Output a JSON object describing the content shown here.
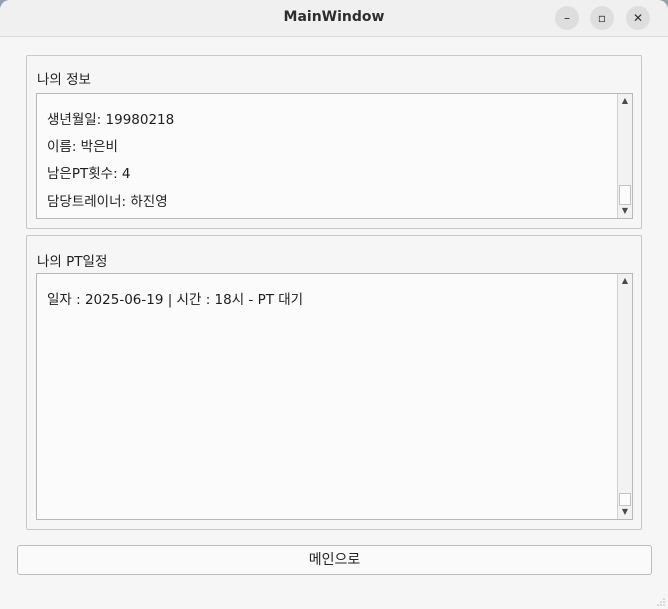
{
  "window": {
    "title": "MainWindow",
    "min_glyph": "–",
    "max_glyph": "▫",
    "close_glyph": "✕"
  },
  "my_info": {
    "title": "나의 정보",
    "items": [
      "생년월일: 19980218",
      "이름: 박은비",
      "남은PT횟수: 4",
      "담당트레이너: 하진영"
    ]
  },
  "my_pt_schedule": {
    "title": "나의 PT일정",
    "items": [
      "일자 : 2025-06-19 | 시간 : 18시  -  PT 대기"
    ]
  },
  "scroll": {
    "up_glyph": "▲",
    "down_glyph": "▼"
  },
  "main_button_label": "메인으로"
}
